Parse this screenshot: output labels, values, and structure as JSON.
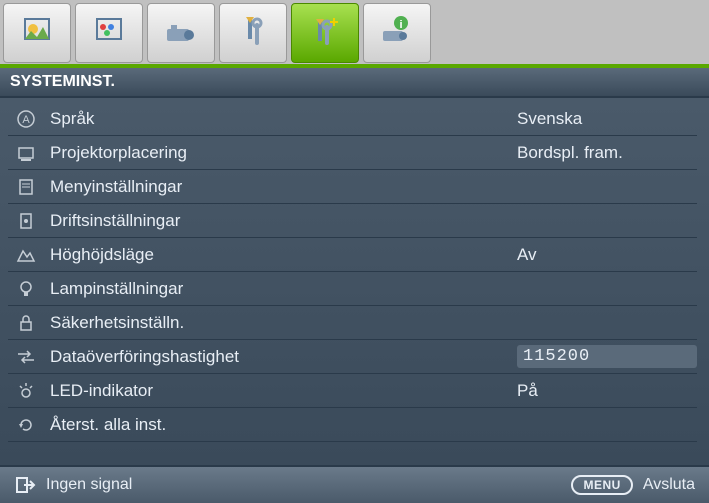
{
  "title": "SYSTEMINST.",
  "items": [
    {
      "label": "Språk",
      "value": "Svenska"
    },
    {
      "label": "Projektorplacering",
      "value": "Bordspl. fram."
    },
    {
      "label": "Menyinställningar",
      "value": ""
    },
    {
      "label": "Driftsinställningar",
      "value": ""
    },
    {
      "label": "Höghöjdsläge",
      "value": "Av"
    },
    {
      "label": "Lampinställningar",
      "value": ""
    },
    {
      "label": "Säkerhetsinställn.",
      "value": ""
    },
    {
      "label": "Dataöverföringshastighet",
      "value": "115200"
    },
    {
      "label": "LED-indikator",
      "value": "På"
    },
    {
      "label": "Återst. alla inst.",
      "value": ""
    }
  ],
  "footer": {
    "status": "Ingen signal",
    "menu_label": "MENU",
    "exit_label": "Avsluta"
  }
}
